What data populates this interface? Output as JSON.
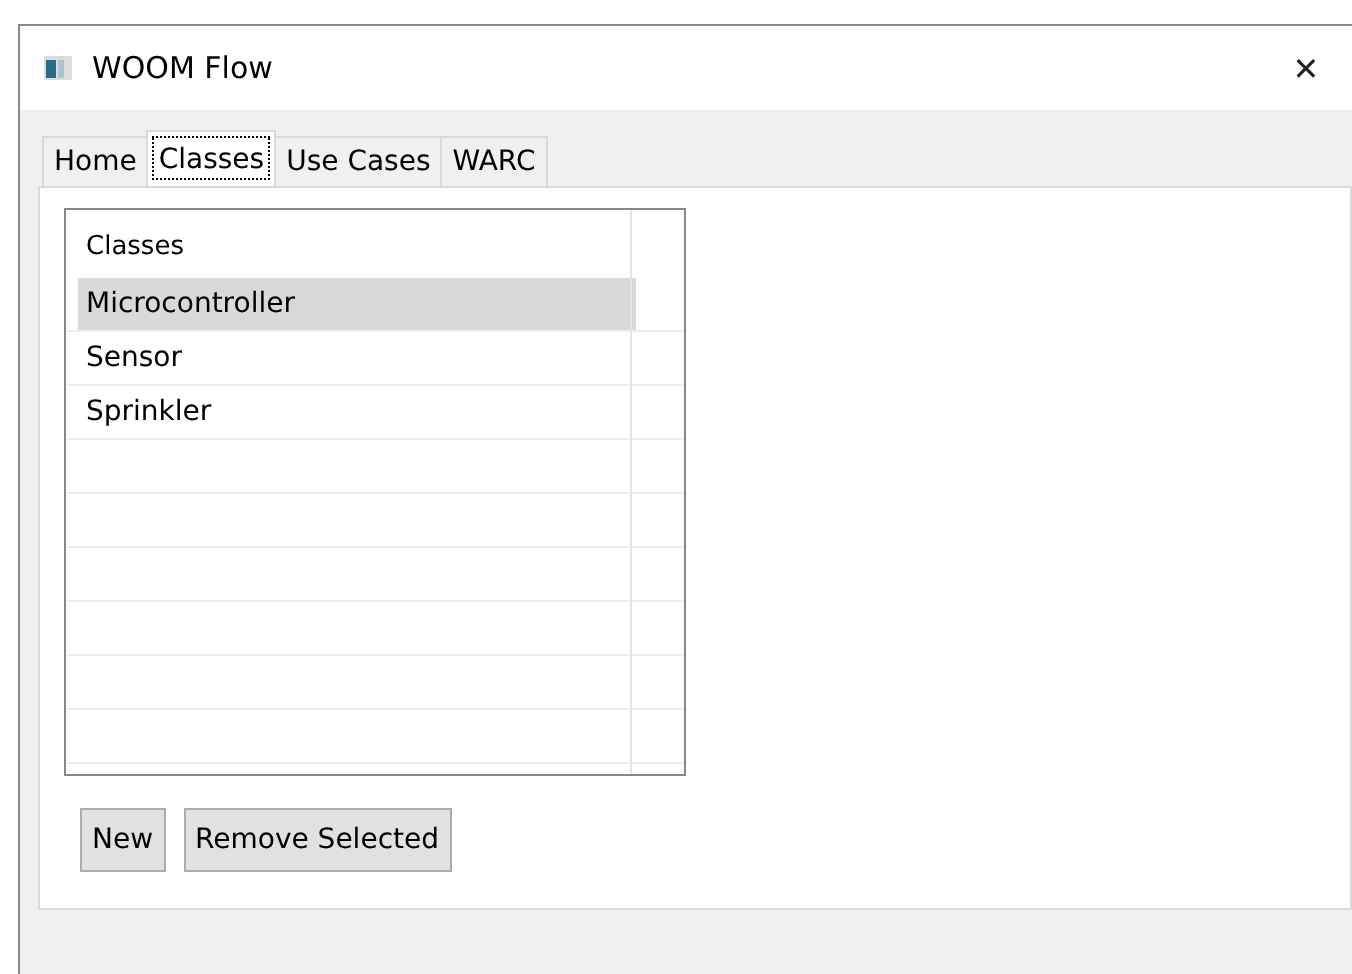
{
  "window": {
    "title": "WOOM Flow",
    "close": "✕"
  },
  "tabs": [
    {
      "label": "Home",
      "selected": false
    },
    {
      "label": "Classes",
      "selected": true
    },
    {
      "label": "Use Cases",
      "selected": false
    },
    {
      "label": "WARC",
      "selected": false
    }
  ],
  "list": {
    "header": "Classes",
    "items": [
      {
        "label": "Microcontroller",
        "selected": true
      },
      {
        "label": "Sensor",
        "selected": false
      },
      {
        "label": "Sprinkler",
        "selected": false
      }
    ]
  },
  "buttons": [
    "New",
    "Remove Selected"
  ]
}
